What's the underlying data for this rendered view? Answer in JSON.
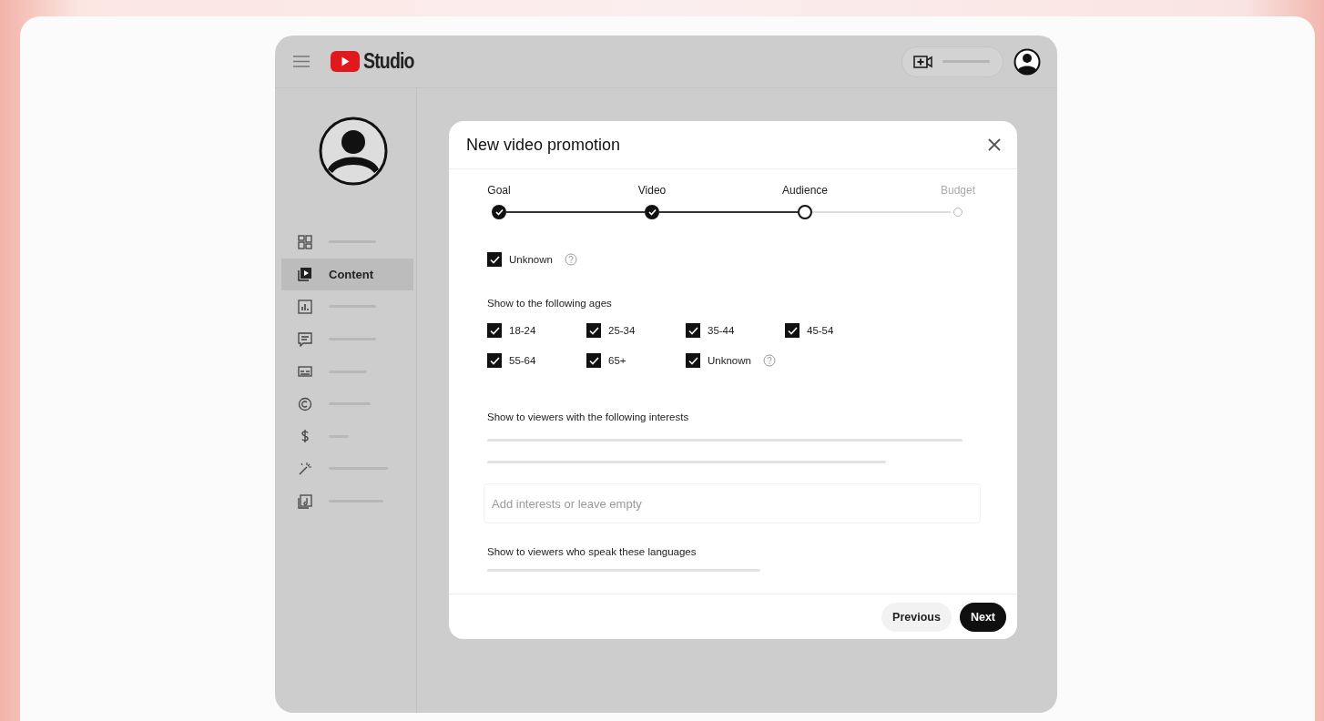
{
  "app": {
    "logo_text": "Studio"
  },
  "sidebar": {
    "items": [
      {
        "selected": false
      },
      {
        "label": "Content",
        "selected": true
      },
      {
        "selected": false
      },
      {
        "selected": false
      },
      {
        "selected": false
      },
      {
        "selected": false
      },
      {
        "selected": false
      },
      {
        "selected": false
      },
      {
        "selected": false
      }
    ]
  },
  "dialog": {
    "title": "New video promotion",
    "steps": [
      {
        "label": "Goal",
        "done": true,
        "current": false
      },
      {
        "label": "Video",
        "done": true,
        "current": false
      },
      {
        "label": "Audience",
        "done": false,
        "current": true
      },
      {
        "label": "Budget",
        "done": false,
        "current": false
      }
    ],
    "gender_unknown": {
      "label": "Unknown",
      "checked": true
    },
    "ages_heading": "Show to the following ages",
    "ages": [
      {
        "label": "18-24",
        "checked": true
      },
      {
        "label": "25-34",
        "checked": true
      },
      {
        "label": "35-44",
        "checked": true
      },
      {
        "label": "45-54",
        "checked": true
      },
      {
        "label": "55-64",
        "checked": true
      },
      {
        "label": "65+",
        "checked": true
      },
      {
        "label": "Unknown",
        "checked": true,
        "help": true
      }
    ],
    "interests_heading": "Show to viewers with the following interests",
    "interests_field": {
      "placeholder": "Add interests or leave empty"
    },
    "languages_heading": "Show to viewers who speak these languages",
    "buttons": [
      {
        "label": "Previous",
        "kind": "secondary"
      },
      {
        "label": "Next",
        "kind": "primary"
      }
    ]
  }
}
